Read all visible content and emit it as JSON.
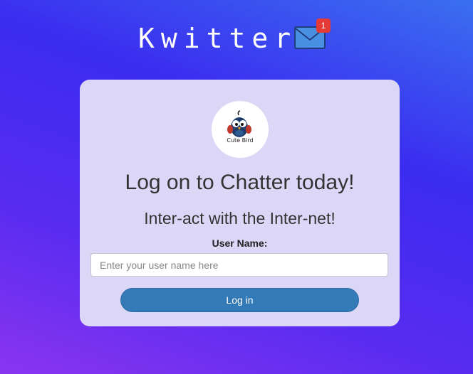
{
  "header": {
    "brand": "Kwitter",
    "mail_icon": "envelope-icon",
    "notification_count": "1"
  },
  "card": {
    "avatar_icon": "cute-bird-logo",
    "avatar_caption": "Cute Bird",
    "title": "Log on to Chatter today!",
    "subtitle": "Inter-act with the Inter-net!",
    "username_label": "User Name:",
    "username_value": "",
    "username_placeholder": "Enter your user name here",
    "login_label": "Log in"
  },
  "colors": {
    "button": "#337ab7",
    "card": "#dcd6f7",
    "badge": "#e53935"
  }
}
